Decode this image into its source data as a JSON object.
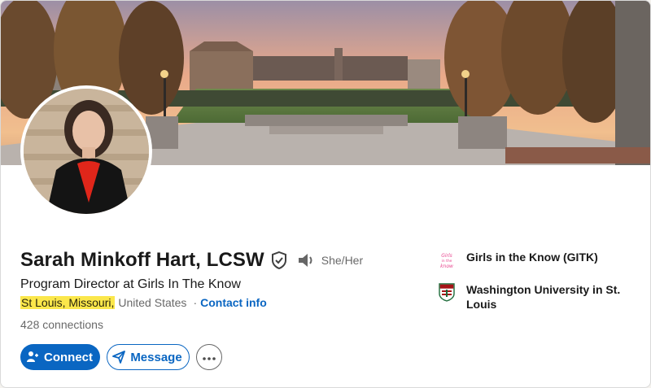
{
  "profile": {
    "name": "Sarah Minkoff Hart, LCSW",
    "pronouns": "She/Her",
    "headline": "Program Director at Girls In The Know",
    "location_highlight": "St Louis, Missouri,",
    "location_rest": "United States",
    "separator": "·",
    "contact_info": "Contact info",
    "connections": "428 connections"
  },
  "actions": {
    "connect_label": "Connect",
    "message_label": "Message",
    "more_label": "More actions"
  },
  "affiliations": [
    {
      "name": "Girls in the Know (GITK)",
      "logo": "girls-in-the-know-logo",
      "logo_text": "Girls in the know"
    },
    {
      "name": "Washington University in St. Louis",
      "logo": "washington-university-shield-logo"
    }
  ],
  "colors": {
    "accent": "#0a66c2",
    "highlight": "#fbe74b",
    "text_secondary": "rgba(0,0,0,0.6)"
  }
}
